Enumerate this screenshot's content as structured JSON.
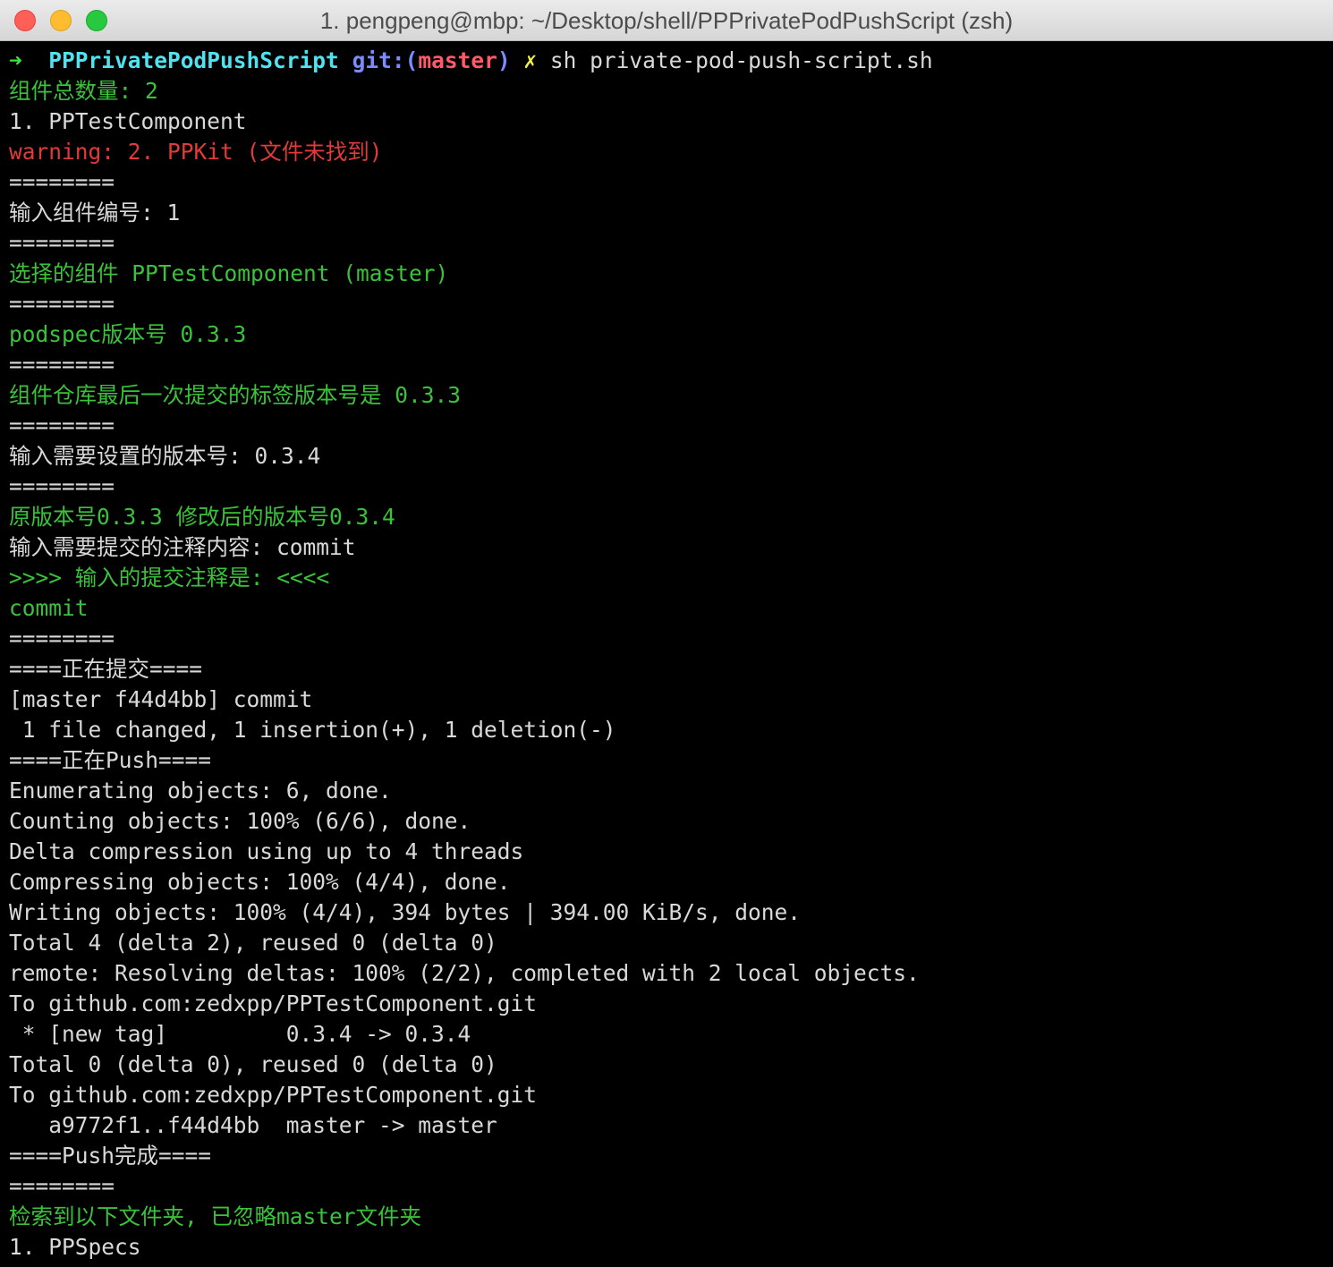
{
  "window": {
    "title": "1. pengpeng@mbp: ~/Desktop/shell/PPPrivatePodPushScript (zsh)"
  },
  "prompt": {
    "arrow": "➜",
    "directory": "PPPrivatePodPushScript",
    "git_prefix": "git:(",
    "branch": "master",
    "git_suffix": ")",
    "dirty_mark": "✗",
    "command": "sh private-pod-push-script.sh"
  },
  "lines": [
    {
      "text": "组件总数量: 2",
      "color": "green"
    },
    {
      "text": "1. PPTestComponent",
      "color": "white"
    },
    {
      "text": "warning: 2. PPKit (文件未找到)",
      "color": "red"
    },
    {
      "text": "========",
      "color": "white"
    },
    {
      "text": "输入组件编号: 1",
      "color": "white"
    },
    {
      "text": "========",
      "color": "white"
    },
    {
      "text": "选择的组件 PPTestComponent (master)",
      "color": "green"
    },
    {
      "text": "========",
      "color": "white"
    },
    {
      "text": "podspec版本号 0.3.3",
      "color": "green"
    },
    {
      "text": "========",
      "color": "white"
    },
    {
      "text": "组件仓库最后一次提交的标签版本号是 0.3.3",
      "color": "green"
    },
    {
      "text": "========",
      "color": "white"
    },
    {
      "text": "输入需要设置的版本号: 0.3.4",
      "color": "white"
    },
    {
      "text": "========",
      "color": "white"
    },
    {
      "text": "原版本号0.3.3 修改后的版本号0.3.4",
      "color": "green"
    },
    {
      "text": "输入需要提交的注释内容: commit",
      "color": "white"
    },
    {
      "text": ">>>> 输入的提交注释是: <<<<",
      "color": "green"
    },
    {
      "text": "commit",
      "color": "green"
    },
    {
      "text": "========",
      "color": "white"
    },
    {
      "text": "====正在提交====",
      "color": "white"
    },
    {
      "text": "[master f44d4bb] commit",
      "color": "white"
    },
    {
      "text": " 1 file changed, 1 insertion(+), 1 deletion(-)",
      "color": "white"
    },
    {
      "text": "====正在Push====",
      "color": "white"
    },
    {
      "text": "Enumerating objects: 6, done.",
      "color": "white"
    },
    {
      "text": "Counting objects: 100% (6/6), done.",
      "color": "white"
    },
    {
      "text": "Delta compression using up to 4 threads",
      "color": "white"
    },
    {
      "text": "Compressing objects: 100% (4/4), done.",
      "color": "white"
    },
    {
      "text": "Writing objects: 100% (4/4), 394 bytes | 394.00 KiB/s, done.",
      "color": "white"
    },
    {
      "text": "Total 4 (delta 2), reused 0 (delta 0)",
      "color": "white"
    },
    {
      "text": "remote: Resolving deltas: 100% (2/2), completed with 2 local objects.",
      "color": "white"
    },
    {
      "text": "To github.com:zedxpp/PPTestComponent.git",
      "color": "white"
    },
    {
      "text": " * [new tag]         0.3.4 -> 0.3.4",
      "color": "white"
    },
    {
      "text": "Total 0 (delta 0), reused 0 (delta 0)",
      "color": "white"
    },
    {
      "text": "To github.com:zedxpp/PPTestComponent.git",
      "color": "white"
    },
    {
      "text": "   a9772f1..f44d4bb  master -> master",
      "color": "white"
    },
    {
      "text": "====Push完成====",
      "color": "white"
    },
    {
      "text": "========",
      "color": "white"
    },
    {
      "text": "检索到以下文件夹, 已忽略master文件夹",
      "color": "green"
    },
    {
      "text": "1. PPSpecs",
      "color": "white"
    }
  ]
}
